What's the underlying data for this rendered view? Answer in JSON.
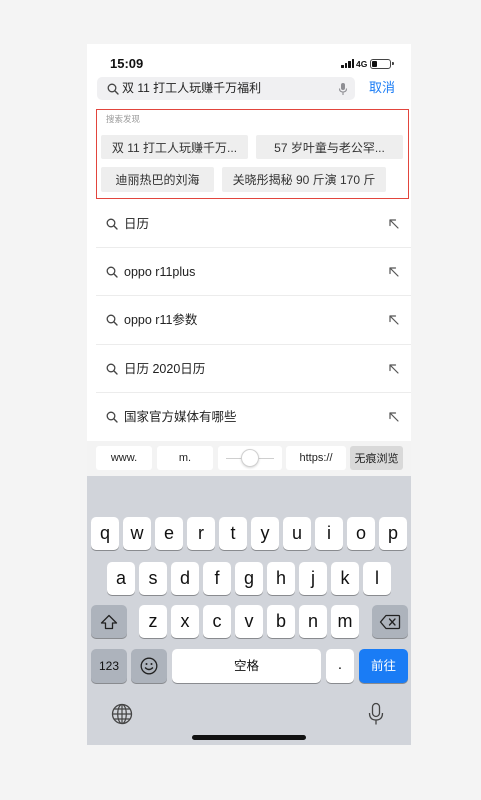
{
  "status_bar": {
    "time": "15:09",
    "network": "4G",
    "battery_level": 0.3
  },
  "search": {
    "query": "双 11 打工人玩赚千万福利",
    "cancel_label": "取消"
  },
  "discover": {
    "title": "搜索发现",
    "chips": [
      "双 11 打工人玩赚千万...",
      "57 岁叶童与老公罕...",
      "迪丽热巴的刘海",
      "关晓彤揭秘 90 斤演 170 斤"
    ]
  },
  "suggestions": [
    "日历",
    "oppo r11plus",
    "oppo r11参数",
    "日历 2020日历",
    "国家官方媒体有哪些"
  ],
  "quick_bar": {
    "www_label": "www.",
    "m_label": "m.",
    "https_label": "https://",
    "incognito_label": "无痕浏览"
  },
  "keyboard": {
    "row1": [
      "q",
      "w",
      "e",
      "r",
      "t",
      "y",
      "u",
      "i",
      "o",
      "p"
    ],
    "row2": [
      "a",
      "s",
      "d",
      "f",
      "g",
      "h",
      "j",
      "k",
      "l"
    ],
    "row3": [
      "z",
      "x",
      "c",
      "v",
      "b",
      "n",
      "m"
    ],
    "numbers_label": "123",
    "space_label": "空格",
    "period_label": ".",
    "go_label": "前往"
  },
  "icons": {
    "search_field": "search-icon",
    "voice_search": "microphone-icon",
    "suggestion": "search-icon",
    "fill_query": "arrow-up-left-icon",
    "shift": "shift-arrow-icon",
    "backspace": "backspace-icon",
    "emoji": "emoji-face-icon",
    "switch_keyboard": "globe-icon",
    "dictation": "microphone-icon",
    "signal": "cellular-signal-icon",
    "battery": "battery-icon"
  },
  "colors": {
    "accent": "#1a7cf5",
    "highlight_border": "#e2453d",
    "keyboard_bg": "#d1d4da",
    "function_key_bg": "#adb3bc",
    "chip_bg": "#eeeeee",
    "page_bg": "#f4f4f4"
  }
}
